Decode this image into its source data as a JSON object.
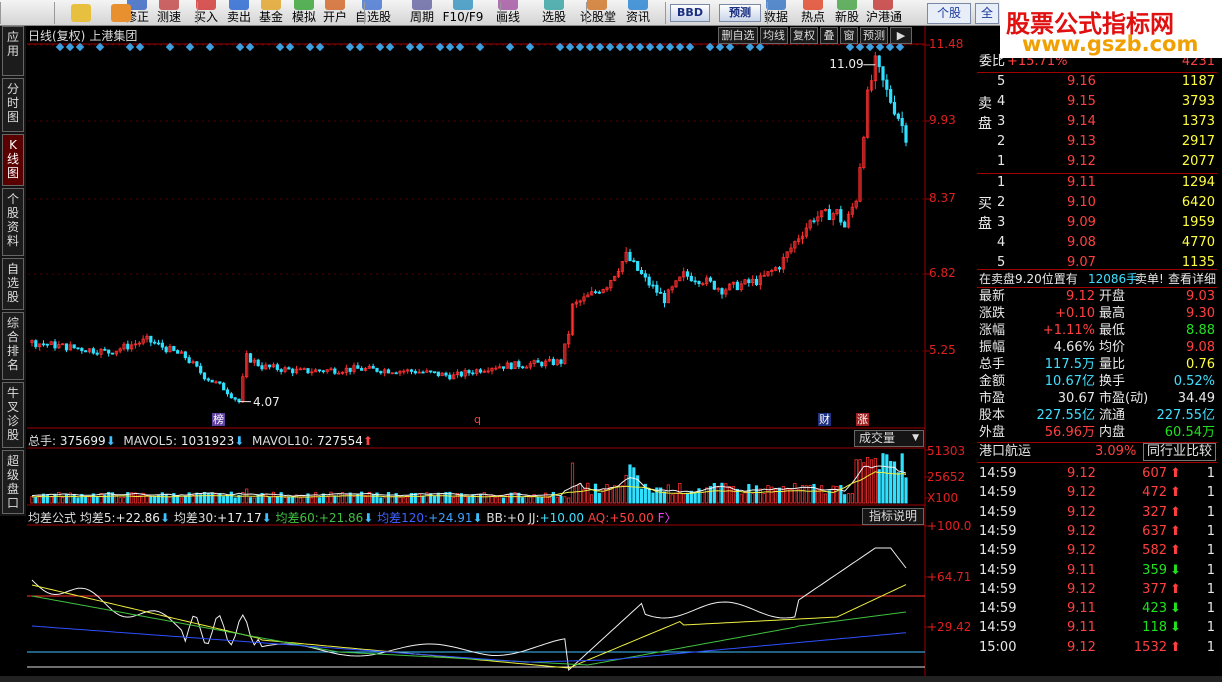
{
  "toolbar": {
    "items": [
      "修正",
      "测速",
      "买入",
      "卖出",
      "基金",
      "模拟",
      "开户",
      "自选股",
      "周期",
      "F10/F9",
      "画线",
      "选股",
      "论股堂",
      "资讯",
      "数据",
      "热点",
      "新股",
      "沪港通"
    ],
    "bbd": "BBD",
    "yuce": "预测",
    "tab_ge": "个股",
    "tab_all": "全"
  },
  "watermark": {
    "cn": "股票公式指标网",
    "url": "www.gszb.com"
  },
  "left_tabs": [
    {
      "label": "应用",
      "active": false
    },
    {
      "label": "分时图",
      "active": false
    },
    {
      "label": "K线图",
      "active": true
    },
    {
      "label": "个股资料",
      "active": false
    },
    {
      "label": "自选股",
      "active": false
    },
    {
      "label": "综合排名",
      "active": false
    },
    {
      "label": "牛叉诊股",
      "active": false
    },
    {
      "label": "超级盘口",
      "active": false
    }
  ],
  "chart_header": {
    "mode": "日线(复权)",
    "stock": "上港集团"
  },
  "chart_controls": [
    "删自选",
    "均线",
    "复权",
    "叠",
    "窗",
    "预测",
    "▶"
  ],
  "price_axis": [
    "11.48",
    "9.93",
    "8.37",
    "6.82",
    "5.25"
  ],
  "price_marks": {
    "high": "11.09",
    "low": "4.07"
  },
  "event_labels": {
    "bang": "榜",
    "q": "q",
    "cai": "财",
    "zhang": "涨"
  },
  "volume": {
    "total_label": "总手:",
    "total": "375699",
    "mavol5_label": "MAVOL5:",
    "mavol5": "1031923",
    "mavol10_label": "MAVOL10:",
    "mavol10": "727554",
    "button": "成交量",
    "axis": [
      "51303",
      "25652",
      "X100"
    ]
  },
  "indicator": {
    "name": "均差公式",
    "d5_label": "均差5:",
    "d5": "+22.86",
    "d30_label": "均差30:",
    "d30": "+17.17",
    "d60_label": "均差60:",
    "d60": "+21.86",
    "d120_label": "均差120:",
    "d120": "+24.91",
    "bb_label": "BB:",
    "bb": "+0",
    "jj_label": "JJ:",
    "jj": "+10.00",
    "aq_label": "AQ:",
    "aq": "+50.00",
    "f_label": "F",
    "button": "指标说明",
    "axis": [
      "+100.0",
      "+64.71",
      "+29.42"
    ]
  },
  "right_panel": {
    "weibi_label": "委比",
    "weibi": "+15.71%",
    "weicha": "4231",
    "sell_label": "卖盘",
    "buy_label": "买盘",
    "sell": [
      {
        "lvl": "5",
        "price": "9.16",
        "vol": "1187"
      },
      {
        "lvl": "4",
        "price": "9.15",
        "vol": "3793"
      },
      {
        "lvl": "3",
        "price": "9.14",
        "vol": "1373"
      },
      {
        "lvl": "2",
        "price": "9.13",
        "vol": "2917"
      },
      {
        "lvl": "1",
        "price": "9.12",
        "vol": "2077"
      }
    ],
    "buy": [
      {
        "lvl": "1",
        "price": "9.11",
        "vol": "1294"
      },
      {
        "lvl": "2",
        "price": "9.10",
        "vol": "6420"
      },
      {
        "lvl": "3",
        "price": "9.09",
        "vol": "1959"
      },
      {
        "lvl": "4",
        "price": "9.08",
        "vol": "4770"
      },
      {
        "lvl": "5",
        "price": "9.07",
        "vol": "1135"
      }
    ],
    "notice": {
      "pre": "在卖盘9.20位置有",
      "num": "12086手",
      "mid": "卖单!",
      "link": "查看详细"
    },
    "quote": [
      {
        "l1": "最新",
        "v1": "9.12",
        "l2": "开盘",
        "v2": "9.03"
      },
      {
        "l1": "涨跌",
        "v1": "+0.10",
        "l2": "最高",
        "v2": "9.30"
      },
      {
        "l1": "涨幅",
        "v1": "+1.11%",
        "l2": "最低",
        "v2": "8.88"
      },
      {
        "l1": "振幅",
        "v1": "4.66%",
        "l2": "均价",
        "v2": "9.08"
      },
      {
        "l1": "总手",
        "v1": "117.5万",
        "l2": "量比",
        "v2": "0.76"
      },
      {
        "l1": "金额",
        "v1": "10.67亿",
        "l2": "换手",
        "v2": "0.52%"
      },
      {
        "l1": "市盈",
        "v1": "30.67",
        "l2": "市盈(动)",
        "v2": "34.49"
      },
      {
        "l1": "股本",
        "v1": "227.55亿",
        "l2": "流通",
        "v2": "227.55亿"
      },
      {
        "l1": "外盘",
        "v1": "56.96万",
        "l2": "内盘",
        "v2": "60.54万"
      }
    ],
    "sector": {
      "name": "港口航运",
      "pct": "3.09%",
      "btn": "同行业比较"
    },
    "ticks": [
      {
        "t": "14:59",
        "p": "9.12",
        "v": "607",
        "d": "up",
        "n": "1"
      },
      {
        "t": "14:59",
        "p": "9.12",
        "v": "472",
        "d": "up",
        "n": "1"
      },
      {
        "t": "14:59",
        "p": "9.12",
        "v": "327",
        "d": "up",
        "n": "1"
      },
      {
        "t": "14:59",
        "p": "9.12",
        "v": "637",
        "d": "up",
        "n": "1"
      },
      {
        "t": "14:59",
        "p": "9.12",
        "v": "582",
        "d": "up",
        "n": "1"
      },
      {
        "t": "14:59",
        "p": "9.11",
        "v": "359",
        "d": "down",
        "n": "1"
      },
      {
        "t": "14:59",
        "p": "9.12",
        "v": "377",
        "d": "up",
        "n": "1"
      },
      {
        "t": "14:59",
        "p": "9.11",
        "v": "423",
        "d": "down",
        "n": "1"
      },
      {
        "t": "14:59",
        "p": "9.11",
        "v": "118",
        "d": "down",
        "n": "1"
      },
      {
        "t": "15:00",
        "p": "9.12",
        "v": "1532",
        "d": "up",
        "n": "1"
      }
    ]
  },
  "colors": {
    "up": "#ff3030",
    "down": "#30e0ff",
    "border": "#a00000"
  }
}
